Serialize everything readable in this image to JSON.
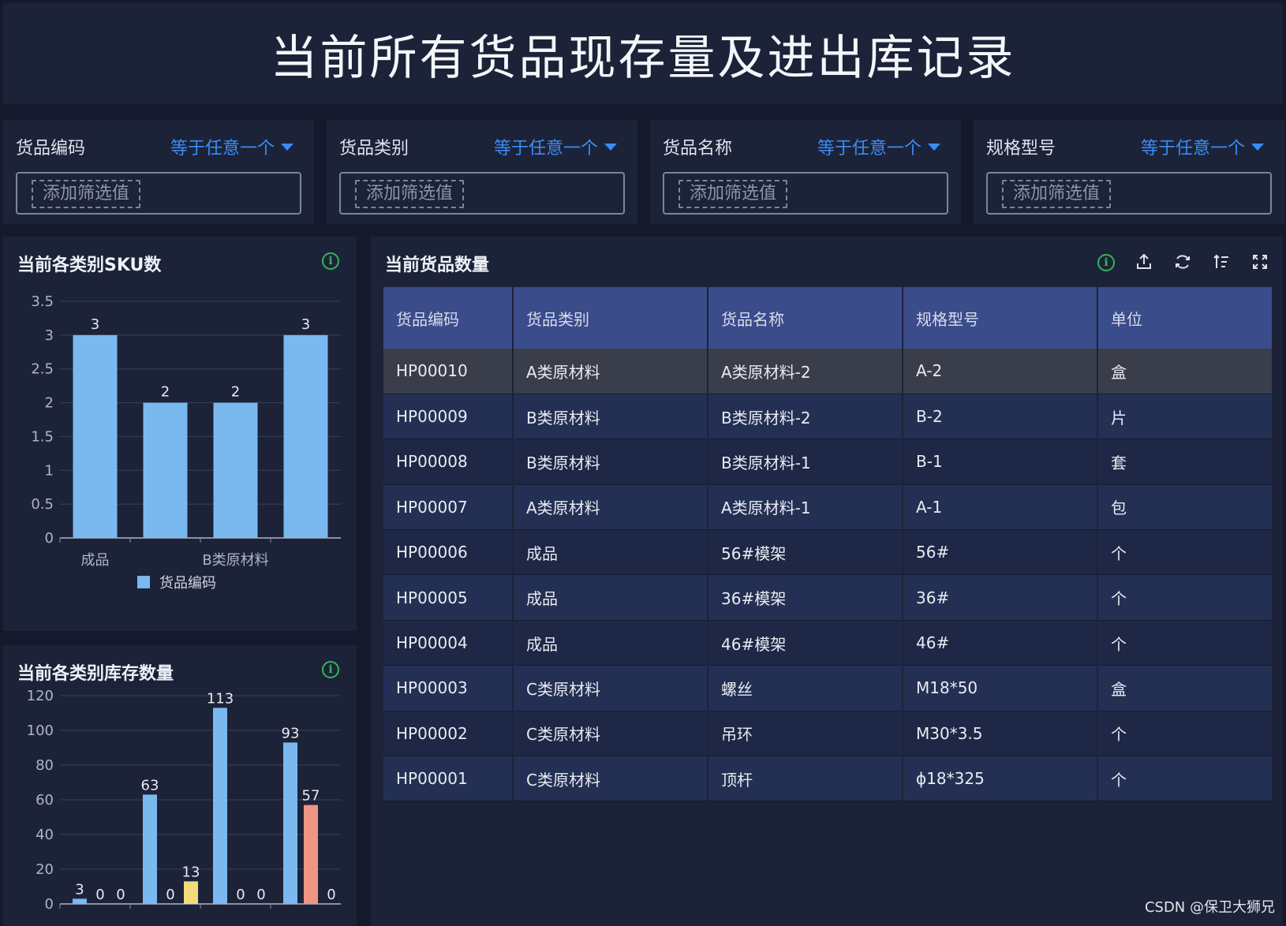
{
  "header": {
    "title": "当前所有货品现存量及进出库记录"
  },
  "filters": [
    {
      "label": "货品编码",
      "operator": "等于任意一个",
      "placeholder": "添加筛选值"
    },
    {
      "label": "货品类别",
      "operator": "等于任意一个",
      "placeholder": "添加筛选值"
    },
    {
      "label": "货品名称",
      "operator": "等于任意一个",
      "placeholder": "添加筛选值"
    },
    {
      "label": "规格型号",
      "operator": "等于任意一个",
      "placeholder": "添加筛选值"
    }
  ],
  "sku_panel": {
    "title": "当前各类别SKU数"
  },
  "stock_panel": {
    "title": "当前各类别库存数量"
  },
  "table_panel": {
    "title": "当前货品数量",
    "columns": [
      "货品编码",
      "货品类别",
      "货品名称",
      "规格型号",
      "单位"
    ],
    "rows": [
      [
        "HP00010",
        "A类原材料",
        "A类原材料-2",
        "A-2",
        "盒"
      ],
      [
        "HP00009",
        "B类原材料",
        "B类原材料-2",
        "B-2",
        "片"
      ],
      [
        "HP00008",
        "B类原材料",
        "B类原材料-1",
        "B-1",
        "套"
      ],
      [
        "HP00007",
        "A类原材料",
        "A类原材料-1",
        "A-1",
        "包"
      ],
      [
        "HP00006",
        "成品",
        "56#模架",
        "56#",
        "个"
      ],
      [
        "HP00005",
        "成品",
        "36#模架",
        "36#",
        "个"
      ],
      [
        "HP00004",
        "成品",
        "46#模架",
        "46#",
        "个"
      ],
      [
        "HP00003",
        "C类原材料",
        "螺丝",
        "M18*50",
        "盒"
      ],
      [
        "HP00002",
        "C类原材料",
        "吊环",
        "M30*3.5",
        "个"
      ],
      [
        "HP00001",
        "C类原材料",
        "顶杆",
        "ϕ18*325",
        "个"
      ]
    ],
    "icons": [
      "info-icon",
      "export-icon",
      "refresh-icon",
      "sort-icon",
      "fullscreen-icon"
    ]
  },
  "watermark": "CSDN @保卫大狮兄",
  "colors": {
    "accent": "#3a8cf5",
    "bar_blue": "#7ab8f0",
    "bar_yellow": "#f2dc7a",
    "bar_salmon": "#ee9585",
    "info_green": "#34b35a"
  },
  "chart_data": [
    {
      "type": "bar",
      "title": "当前各类别SKU数",
      "categories": [
        "成品",
        "",
        "B类原材料",
        ""
      ],
      "series": [
        {
          "name": "货品编码",
          "values": [
            3,
            2,
            2,
            3
          ]
        }
      ],
      "ylim": [
        0,
        3.5
      ],
      "yticks": [
        "0",
        "0.5",
        "1",
        "1.5",
        "2",
        "2.5",
        "3",
        "3.5"
      ],
      "grid": true,
      "legend": "bottom"
    },
    {
      "type": "bar",
      "title": "当前各类别库存数量",
      "groups": [
        {
          "values": [
            3,
            0,
            0
          ]
        },
        {
          "values": [
            63,
            0,
            13
          ]
        },
        {
          "values": [
            113,
            0,
            0
          ]
        },
        {
          "values": [
            93,
            57,
            0
          ]
        }
      ],
      "ylim": [
        0,
        120
      ],
      "yticks": [
        "0",
        "20",
        "40",
        "60",
        "80",
        "100",
        "120"
      ],
      "grid": true
    }
  ]
}
